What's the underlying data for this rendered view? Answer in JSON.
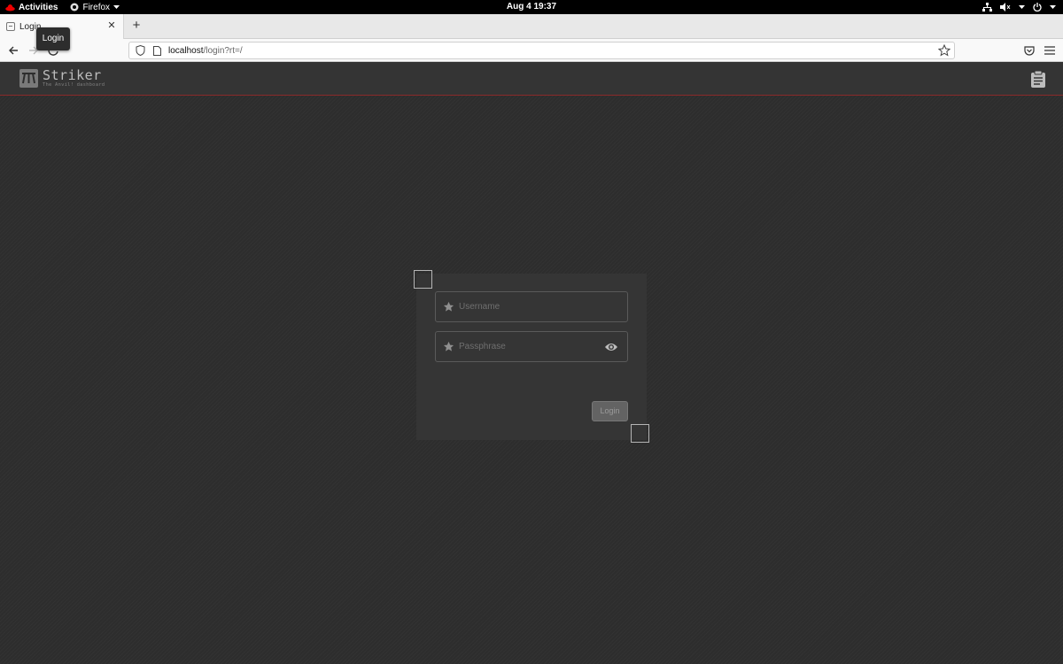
{
  "system_bar": {
    "activities": "Activities",
    "app_menu": "Firefox",
    "clock": "Aug 4  19:37"
  },
  "browser": {
    "tab_title": "Login",
    "tooltip": "Login",
    "url_host": "localhost",
    "url_path": "/login?rt=/"
  },
  "app": {
    "brand": "Striker",
    "tagline": "The Anvil! dashboard"
  },
  "login_form": {
    "username_placeholder": "Username",
    "passphrase_placeholder": "Passphrase",
    "login_label": "Login"
  },
  "colors": {
    "background": "#2d2d2d",
    "header": "#343434",
    "header_border": "#8a2a2a",
    "panel": "#353535"
  }
}
